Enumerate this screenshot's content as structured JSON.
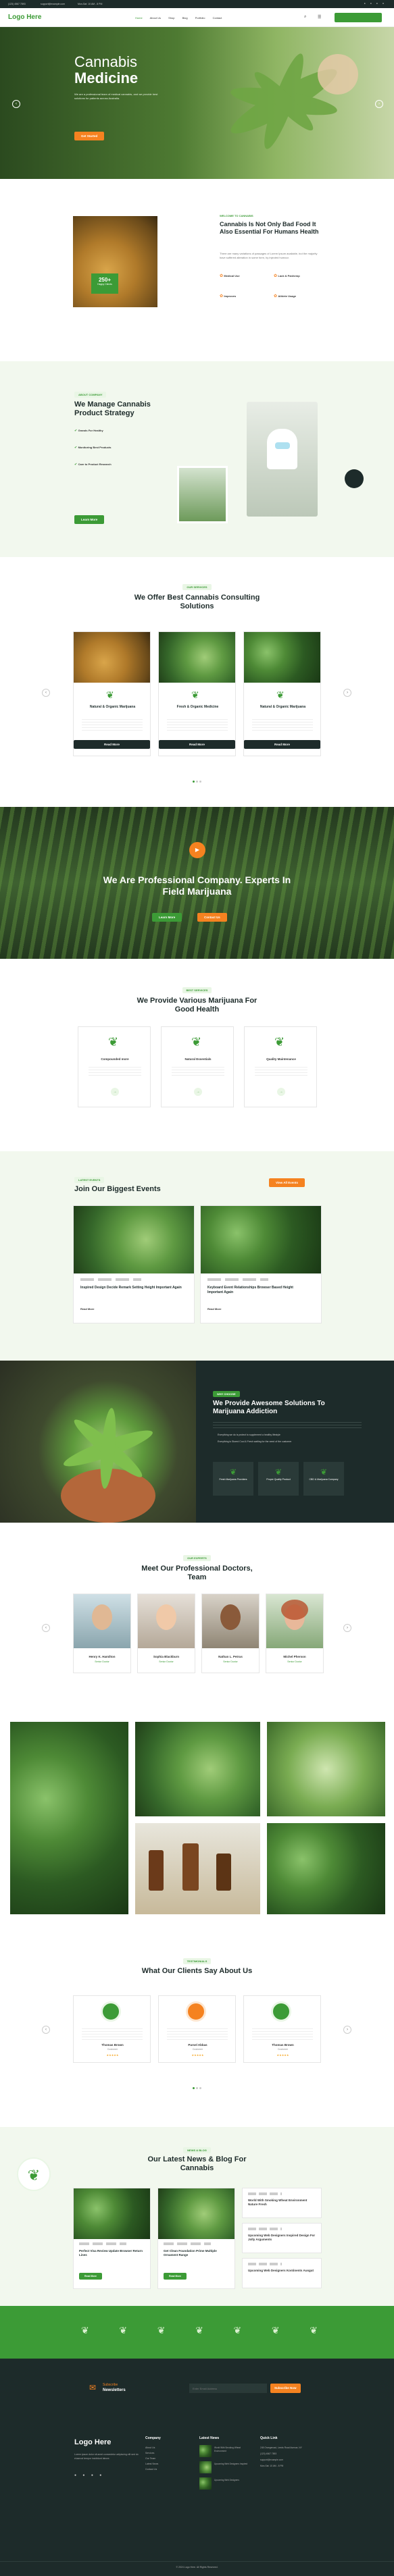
{
  "topbar": {
    "phone": "(123) 4567 7893",
    "email": "support@example.com",
    "hours": "Mon-Sat: 10 AM - 8 PM"
  },
  "header": {
    "logo": "Logo Here",
    "nav": [
      "Home",
      "About Us",
      "Shop",
      "Blog",
      "Portfolio",
      "Contact"
    ]
  },
  "hero": {
    "title1": "Cannabis",
    "title2": "Medicine",
    "desc": "We are a professional team of medical cannabis, and we provide best solutions for patients across Australia.",
    "button": "Get Started"
  },
  "about": {
    "tag": "WELCOME TO CANNABIS",
    "title": "Cannabis Is Not Only Bad Food It Also Essential For Humans Health",
    "desc": "There are many variations of passages of Lorem Ipsum available, but the majority have suffered alteration in some form, by injected humour.",
    "badge_num": "250+",
    "badge_text": "Happy Clients",
    "features": [
      "Medical Use",
      "Lack & Panhemp",
      "Improves",
      "Athlete Usage"
    ]
  },
  "strategy": {
    "tag": "ABOUT COMPANY",
    "title": "We Manage Cannabis Product Strategy",
    "items": [
      "Grands For Healthy",
      "Monitoring Best Products",
      "Care to Product Research"
    ],
    "button": "Learn More"
  },
  "consulting": {
    "tag": "OUR SERVICES",
    "title": "We Offer Best Cannabis Consulting Solutions",
    "items": [
      {
        "title": "Natural & Organic Marijuana",
        "button": "Read More"
      },
      {
        "title": "Fresh & Organic Medicine",
        "button": "Read More"
      },
      {
        "title": "Natural & Organic Marijuana",
        "button": "Read More"
      }
    ]
  },
  "video": {
    "title": "We Are Professional Company. Experts In Field Marijuana",
    "btn1": "Learn More",
    "btn2": "Contact Us"
  },
  "health": {
    "tag": "BEST SERVICES",
    "title": "We Provide Various Marijuana For Good Health",
    "items": [
      "Compounded more",
      "Natural Essentials",
      "Quality Maintenance"
    ]
  },
  "events": {
    "tag": "LATEST EVENTS",
    "title": "Join Our Biggest Events",
    "button": "View All Events",
    "items": [
      {
        "title": "Inspired Design Decide Remark Setting Height Important Again",
        "link": "Read More"
      },
      {
        "title": "Keyboard Event Relationships Browser Based Height Important Again",
        "link": "Read More"
      }
    ]
  },
  "solutions": {
    "tag": "WHY CHOOSE",
    "title": "We Provide Awesome Solutions To Marijuana Addiction",
    "points": [
      "Everything we do is protect to supplement a healthy lifestyle",
      "Everything is Stored Cool & Fresh waiting for the need of the customer"
    ],
    "boxes": [
      "Fresh Marijuana Providers",
      "Proper Quality Product",
      "CBD & Marijuana Company"
    ]
  },
  "team": {
    "tag": "OUR EXPERTS",
    "title": "Meet Our Professional Doctors, Team",
    "members": [
      {
        "name": "Henry K. Hamilton",
        "role": "Senior Doctor"
      },
      {
        "name": "Sophia Blackburn",
        "role": "Senior Doctor"
      },
      {
        "name": "Nathan L. Petrus",
        "role": "Senior Doctor"
      },
      {
        "name": "Michel Pherson",
        "role": "Senior Doctor"
      }
    ]
  },
  "testimonials": {
    "tag": "TESTIMONIALS",
    "title": "What Our Clients Say About Us",
    "items": [
      {
        "name": "Thomas Brown",
        "role": "Customer"
      },
      {
        "name": "Parsel Abbas",
        "role": "Customer"
      },
      {
        "name": "Thomas Brown",
        "role": "Customer"
      }
    ]
  },
  "news": {
    "tag": "NEWS & BLOG",
    "title": "Our Latest News & Blog For Cannabis",
    "main": [
      {
        "title": "Perfect Visa Review Update Browser Return Lines",
        "button": "Read More"
      },
      {
        "title": "Get Clean Foundation Prime Multiple Ornament Range",
        "button": "Read More"
      }
    ],
    "side": [
      "World With Smoking Wheat Environment Nature Fresh",
      "Upcoming Web Designers Inspired Design For Jolly Arguments",
      "Upcoming Web Designers Kontinents Ausgut"
    ]
  },
  "newsletter": {
    "title1": "Subscribe",
    "title2": "Newsletters",
    "placeholder": "Enter Email Address",
    "button": "Subscribe Now"
  },
  "footer": {
    "logo": "Logo Here",
    "desc": "Lorem ipsum dolor sit amet consectetur adipiscing elit sed do eiusmod tempor incididunt labore.",
    "company_title": "Company",
    "company": [
      "About Us",
      "Services",
      "Our Team",
      "Latest News",
      "Contact Us"
    ],
    "news_title": "Latest News",
    "news": [
      "World With Smoking Wheat Environment",
      "Upcoming Web Designers Inspired",
      "Upcoming Web Designers"
    ],
    "contact_title": "Quick Link",
    "contacts": [
      "245 Orangeroad, Leeds Road Avenue, NY",
      "(123) 4567 7893",
      "support@example.com",
      "Mon-Sat: 10 AM - 8 PM"
    ],
    "copyright": "© 2024 Logo Here. All Rights Reserved."
  }
}
